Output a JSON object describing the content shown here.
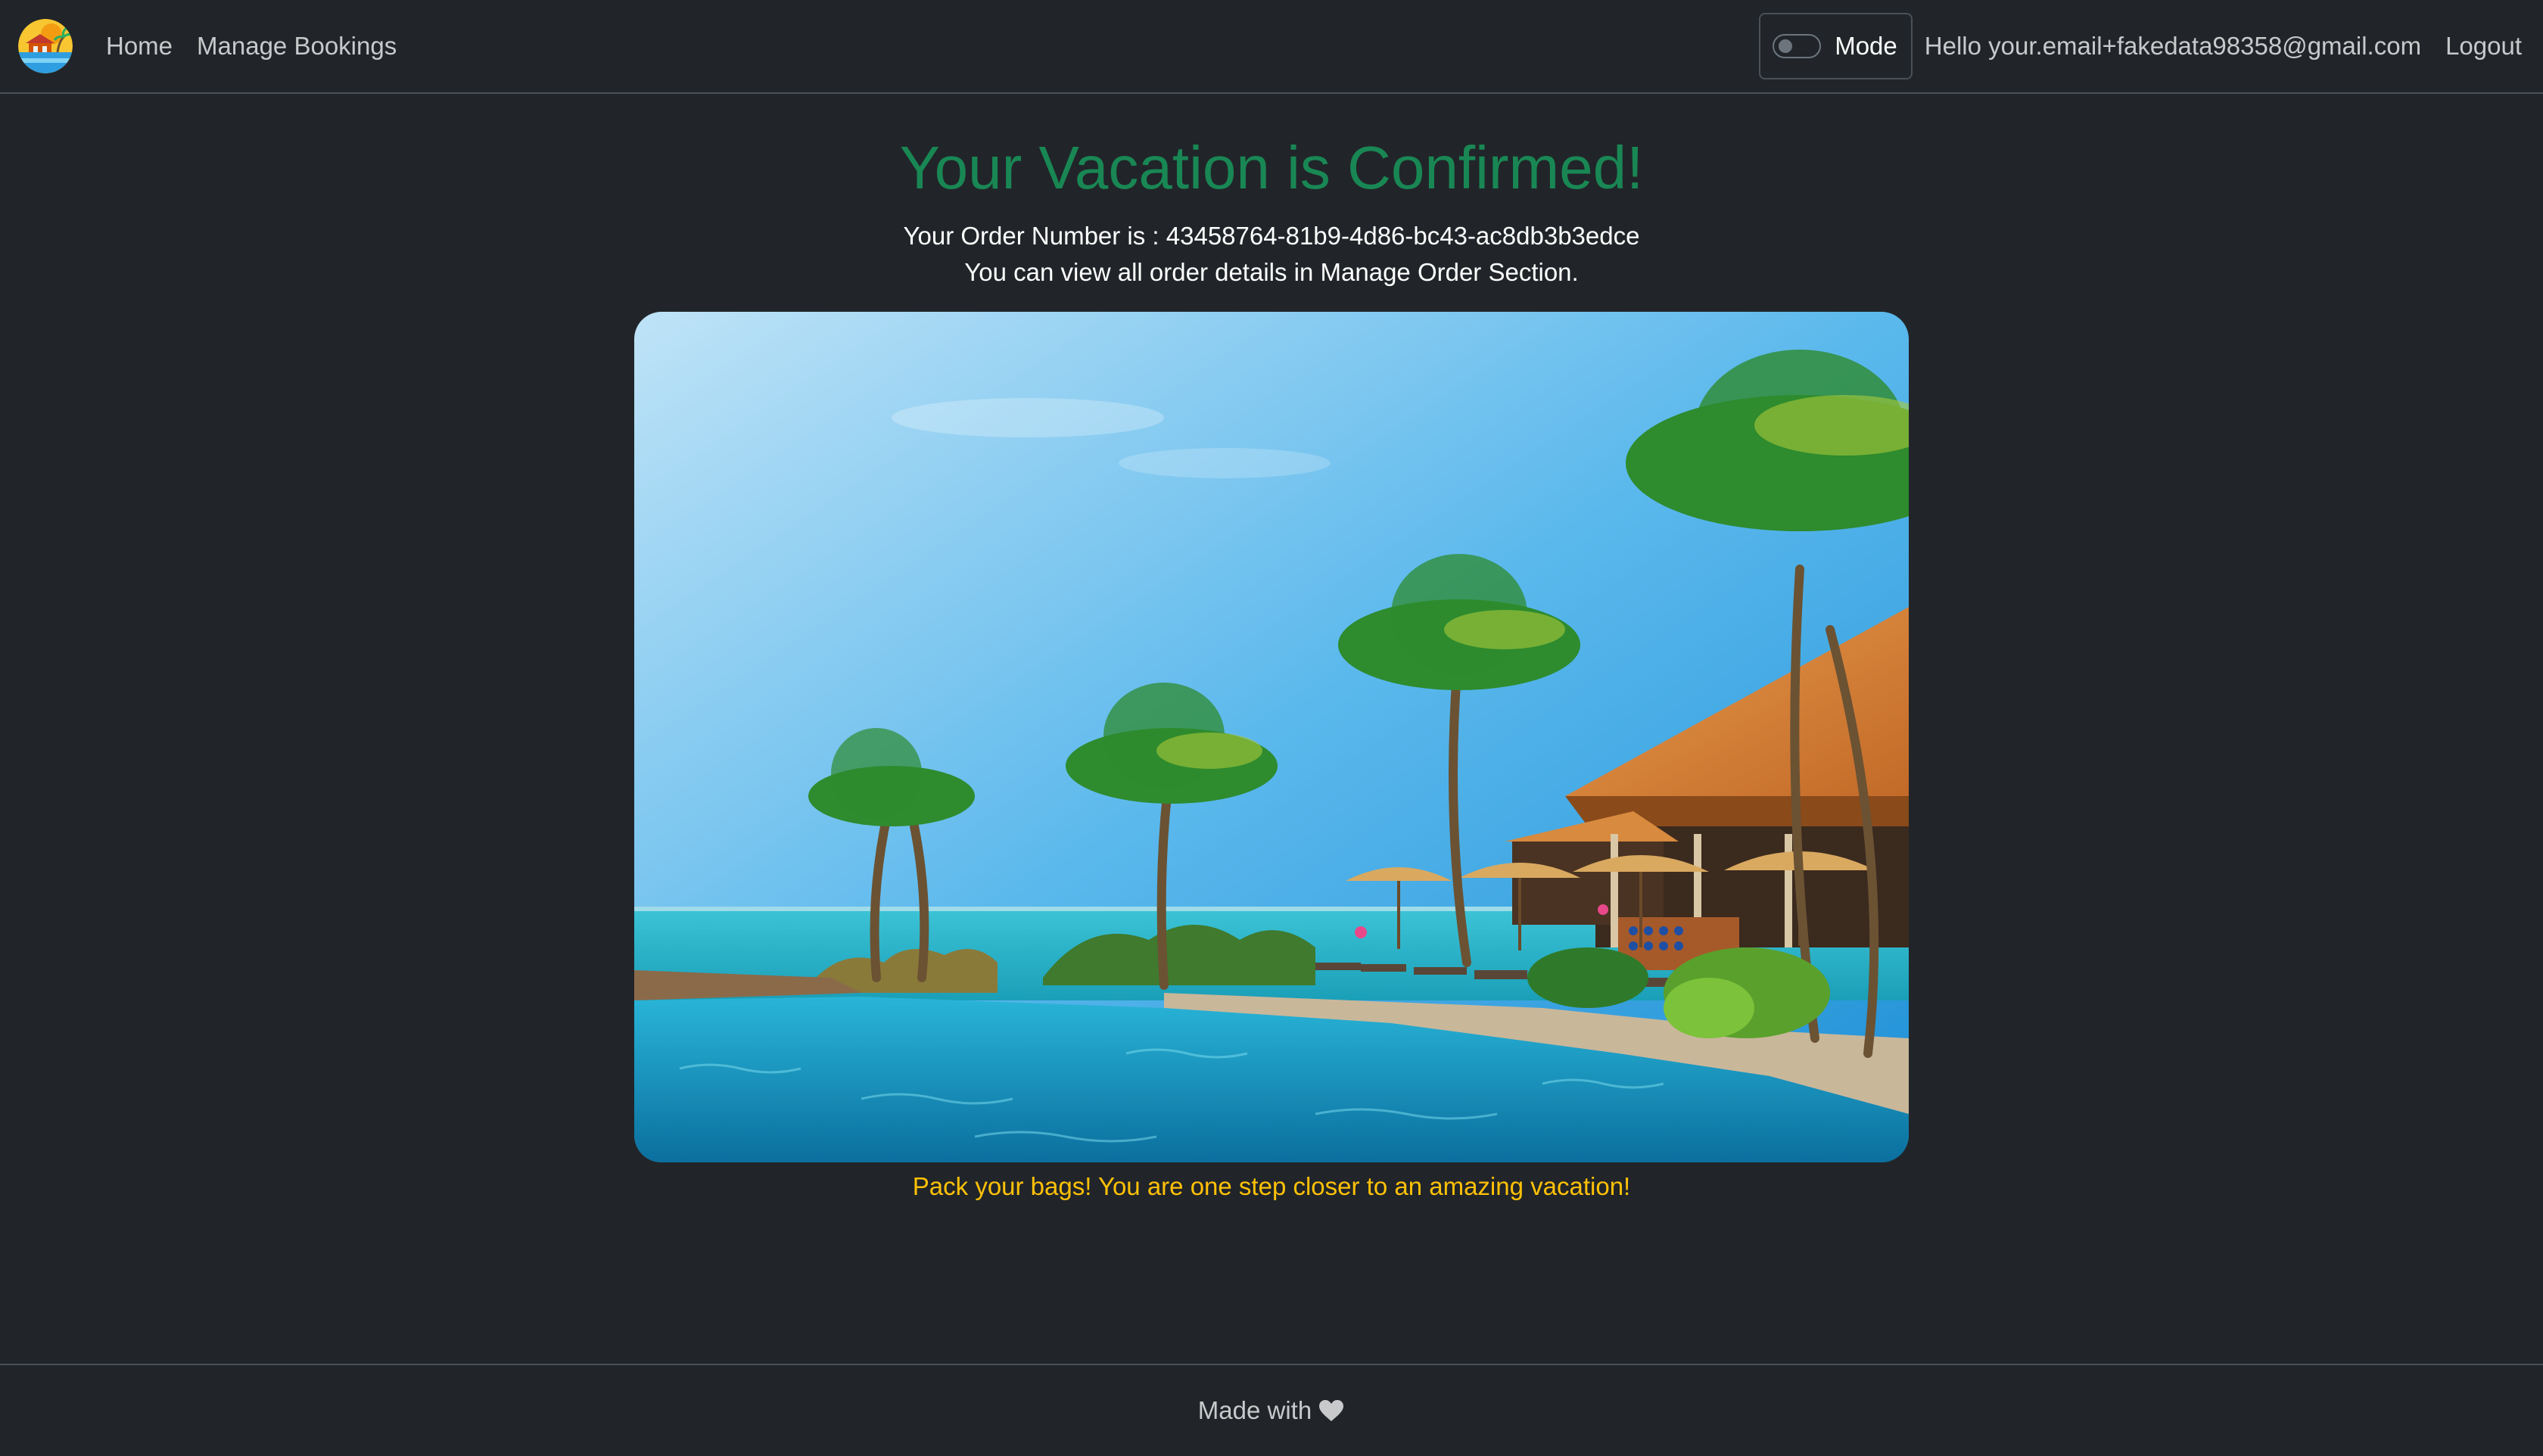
{
  "nav": {
    "home_label": "Home",
    "bookings_label": "Manage Bookings",
    "mode_label": "Mode",
    "greeting": "Hello your.email+fakedata98358@gmail.com",
    "logout_label": "Logout",
    "mode_toggle_state": "off"
  },
  "main": {
    "title": "Your Vacation is Confirmed!",
    "order_line": "Your Order Number is : 43458764-81b9-4d86-bc43-ac8db3b3edce",
    "details_line": "You can view all order details in Manage Order Section.",
    "tagline": "Pack your bags! You are one step closer to an amazing vacation!"
  },
  "footer": {
    "text": "Made with",
    "icon": "heart-icon"
  },
  "colors": {
    "background": "#212529",
    "title": "#198754",
    "tagline": "#ffc107",
    "nav_text": "#c8c9cb"
  }
}
